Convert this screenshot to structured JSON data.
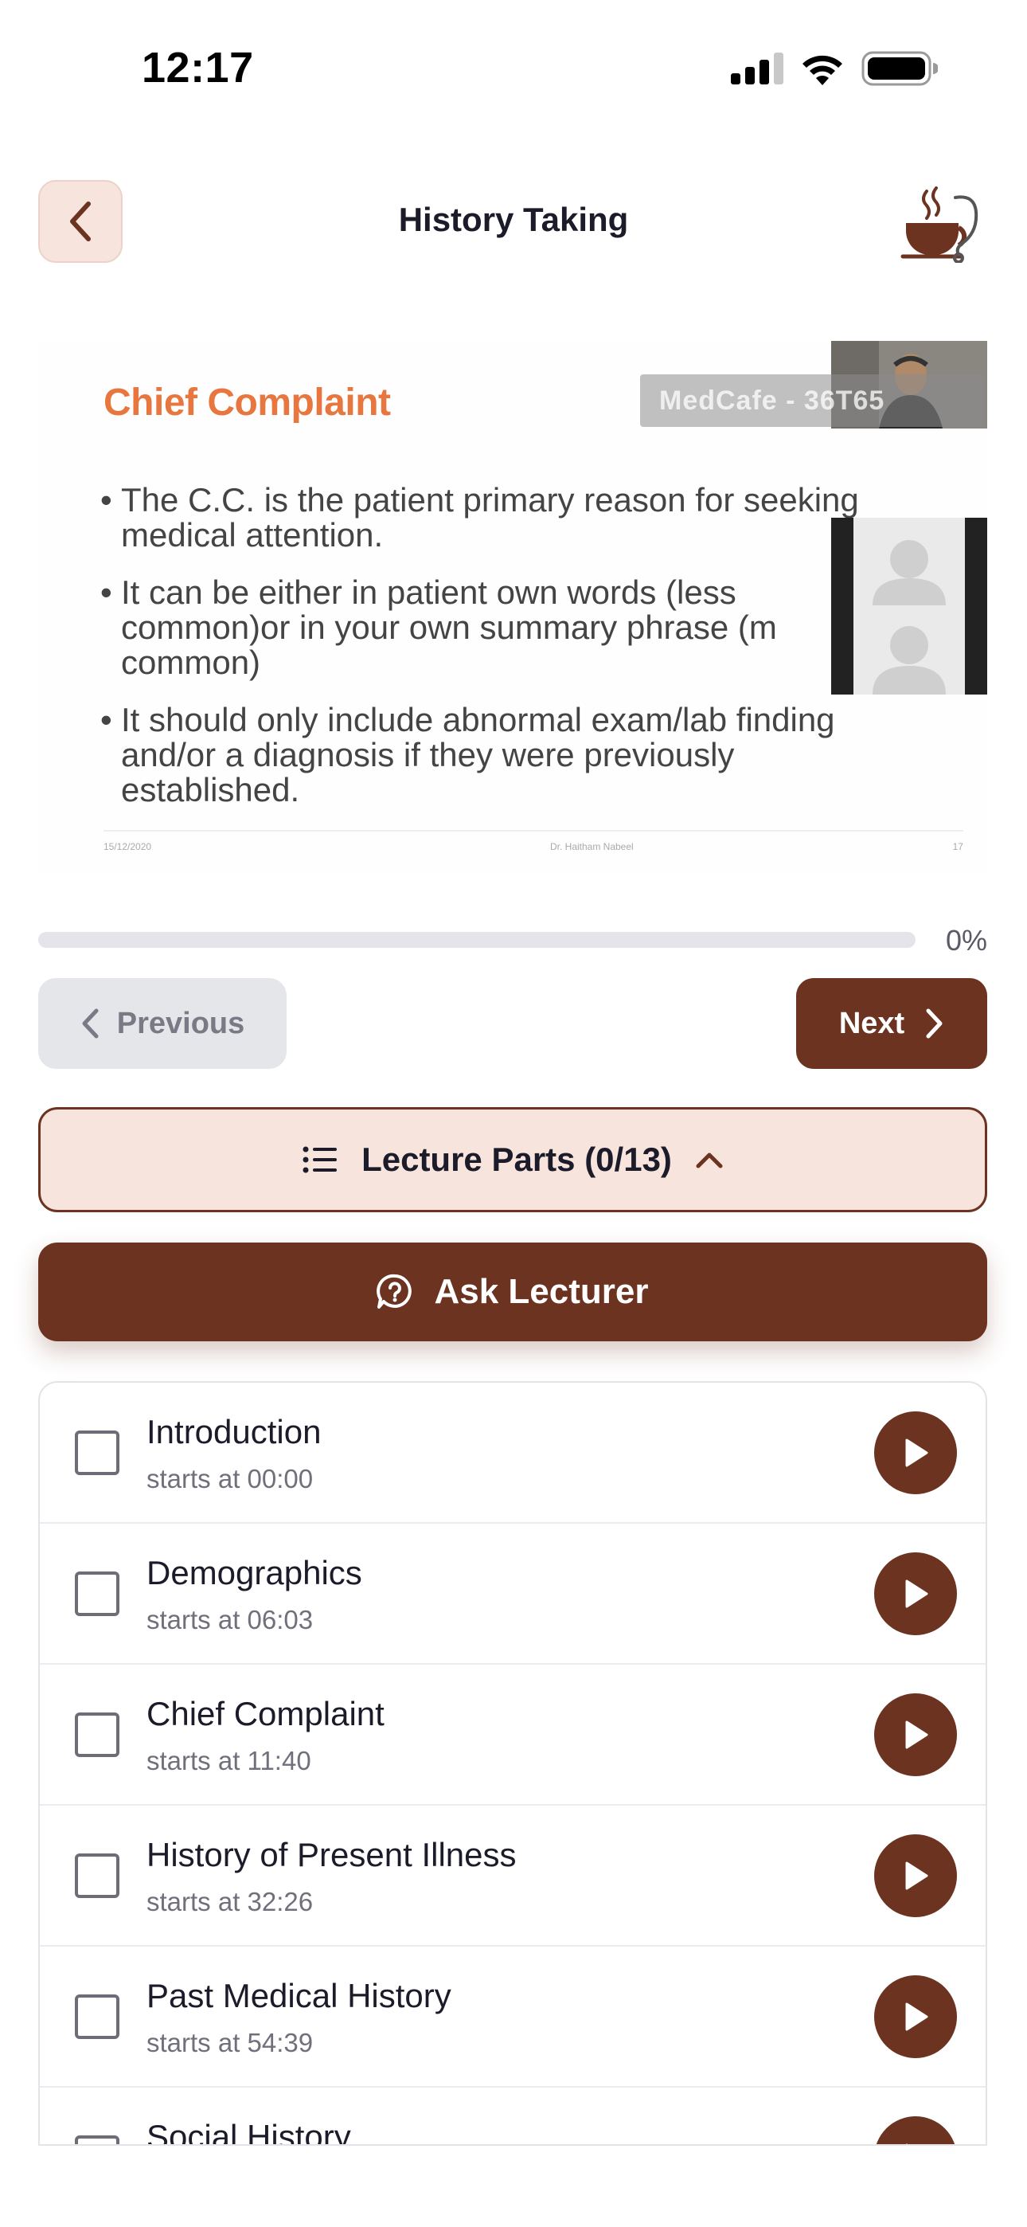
{
  "status_bar": {
    "time": "12:17"
  },
  "header": {
    "title": "History Taking"
  },
  "video": {
    "slide_title": "Chief Complaint",
    "watermark": "MedCafe - 36T65",
    "bullets": [
      "The C.C. is the patient primary reason for seeking medical attention.",
      "It can be either in patient own words (less common)or in your own summary phrase (m common)",
      "It should only include abnormal exam/lab finding and/or a diagnosis if they were previously established."
    ],
    "footer": {
      "date": "15/12/2020",
      "author": "Dr. Haitham Nabeel",
      "page": "17"
    }
  },
  "progress": {
    "percent_label": "0%",
    "fraction": 0.0
  },
  "nav": {
    "previous_label": "Previous",
    "next_label": "Next"
  },
  "parts_toggle": {
    "label": "Lecture Parts (0/13)"
  },
  "ask": {
    "label": "Ask Lecturer"
  },
  "parts": [
    {
      "title": "Introduction",
      "time": "starts at 00:00"
    },
    {
      "title": "Demographics",
      "time": "starts at 06:03"
    },
    {
      "title": "Chief Complaint",
      "time": "starts at 11:40"
    },
    {
      "title": "History of Present Illness",
      "time": "starts at 32:26"
    },
    {
      "title": "Past Medical History",
      "time": "starts at 54:39"
    },
    {
      "title": "Social History",
      "time": ""
    }
  ],
  "colors": {
    "accent": "#6b3320",
    "accent_light": "#f6e4dd",
    "slide_title": "#e8773f"
  }
}
